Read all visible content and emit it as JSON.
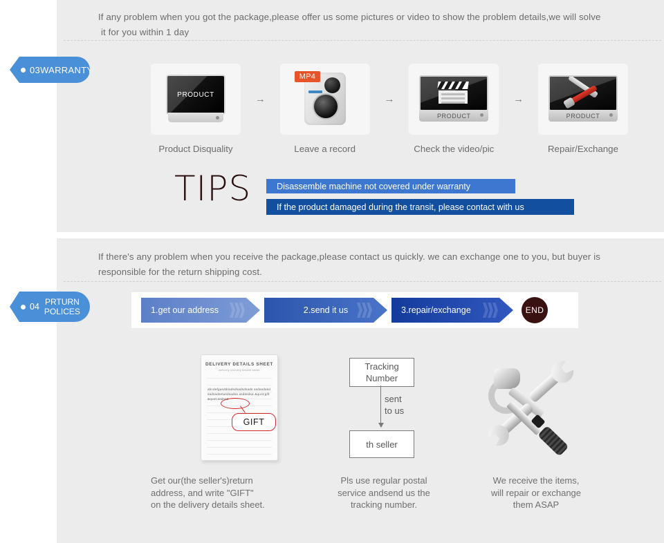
{
  "colors": {
    "panel_bg": "#ececec",
    "badge_blue": "#4a90d9",
    "tip_bar_light": "#3d77cf",
    "tip_bar_dark": "#12509f",
    "end_circle": "#3a1111",
    "accent_orange": "#e8542a",
    "gift_red": "#d42a2a"
  },
  "warranty_section": {
    "badge": {
      "dot": "bullet-dot",
      "number": "03",
      "label": "WARRANTY"
    },
    "intro_line1": "If any problem when you got the package,please offer us some pictures or video to show the problem details,we will solve",
    "intro_line2": "it for you within 1 day",
    "flow_arrow": "→",
    "steps": [
      {
        "label": "Product Disquality",
        "icon": "monitor-icon",
        "screen_text": "PRODUCT"
      },
      {
        "label": "Leave a record",
        "icon": "camcorder-icon",
        "tag": "MP4"
      },
      {
        "label": "Check the video/pic",
        "icon": "clapperboard-monitor-icon",
        "screen_text": "PRODUCT"
      },
      {
        "label": "Repair/Exchange",
        "icon": "tools-monitor-icon",
        "screen_text": "PRODUCT"
      }
    ],
    "tips": {
      "title": "TIPS",
      "bar1": "Disassemble machine not covered under warranty",
      "bar2": "If the product damaged during the transit, please contact with us"
    }
  },
  "return_section": {
    "badge": {
      "dot": "bullet-dot",
      "number": "04",
      "label_line1": "PRTURN",
      "label_line2": "POLICES"
    },
    "intro_line1": "If  there's any problem when you receive the package,please contact us quickly. we can exchange one to you, but buyer is",
    "intro_line2": "responsible for the return shipping cost.",
    "steps": [
      {
        "label": "1.get our address"
      },
      {
        "label": "2.send it us"
      },
      {
        "label": "3.repair/exchange"
      }
    ],
    "end_label": "END",
    "columns": [
      {
        "icon": "delivery-sheet-icon",
        "sheet_title": "DELIVERY DETAILS SHEET",
        "sheet_subtitle": "delivery          delivery details sheet",
        "sheet_body": "abcdefgasddsadsdsadsdsads asdasdasdsadsadsetasdsadsa asdasdsa  &quot;gift&quot;asdsad",
        "callout": "GIFT",
        "caption_line1": "Get our(the seller's)return",
        "caption_line2": "address, and write \"GIFT\"",
        "caption_line3": "on the delivery details sheet."
      },
      {
        "icon": "flow-diagram-icon",
        "box_top": "Tracking Number",
        "arrow_label_line1": "sent",
        "arrow_label_line2": "to us",
        "box_bottom": "th seller",
        "caption_line1": "Pls use regular postal",
        "caption_line2": "service andsend us the",
        "caption_line3": " tracking number."
      },
      {
        "icon": "hammer-wrench-screwdriver-icon",
        "caption_line1": "We receive the items,",
        "caption_line2": "will repair or exchange",
        "caption_line3": " them ASAP"
      }
    ]
  }
}
